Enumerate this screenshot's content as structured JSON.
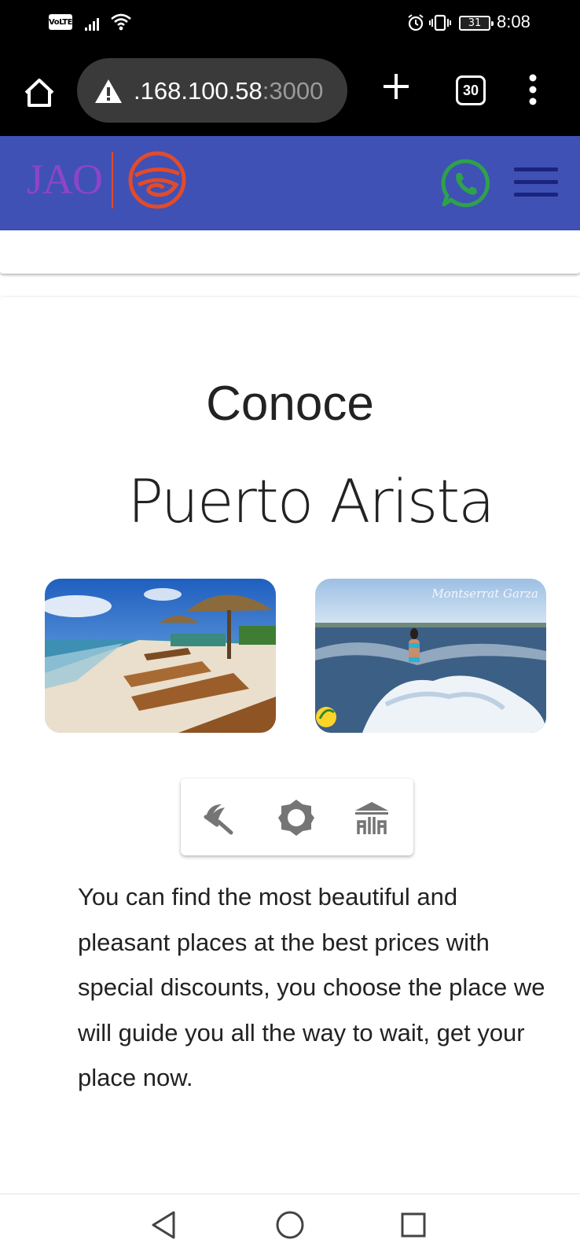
{
  "status_bar": {
    "network_badge": "VoLTE",
    "battery_level": "31",
    "time": "8:08"
  },
  "browser": {
    "url_host": ".168.100.58",
    "url_port": ":3000",
    "tab_count": "30"
  },
  "header": {
    "logo_text": "JAO",
    "background_color": "#3f51b5",
    "whatsapp_color": "#2ea24a"
  },
  "content": {
    "title_small": "Conoce",
    "title_large": "Puerto Arista",
    "photo_watermark": "Montserrat Garza",
    "icons": [
      "beach-umbrella-icon",
      "sun-icon",
      "house-icon"
    ],
    "description": "You can find the most beautiful and pleasant places at the best prices with special discounts, you choose the place we will guide you all the way to wait, get your place now."
  }
}
